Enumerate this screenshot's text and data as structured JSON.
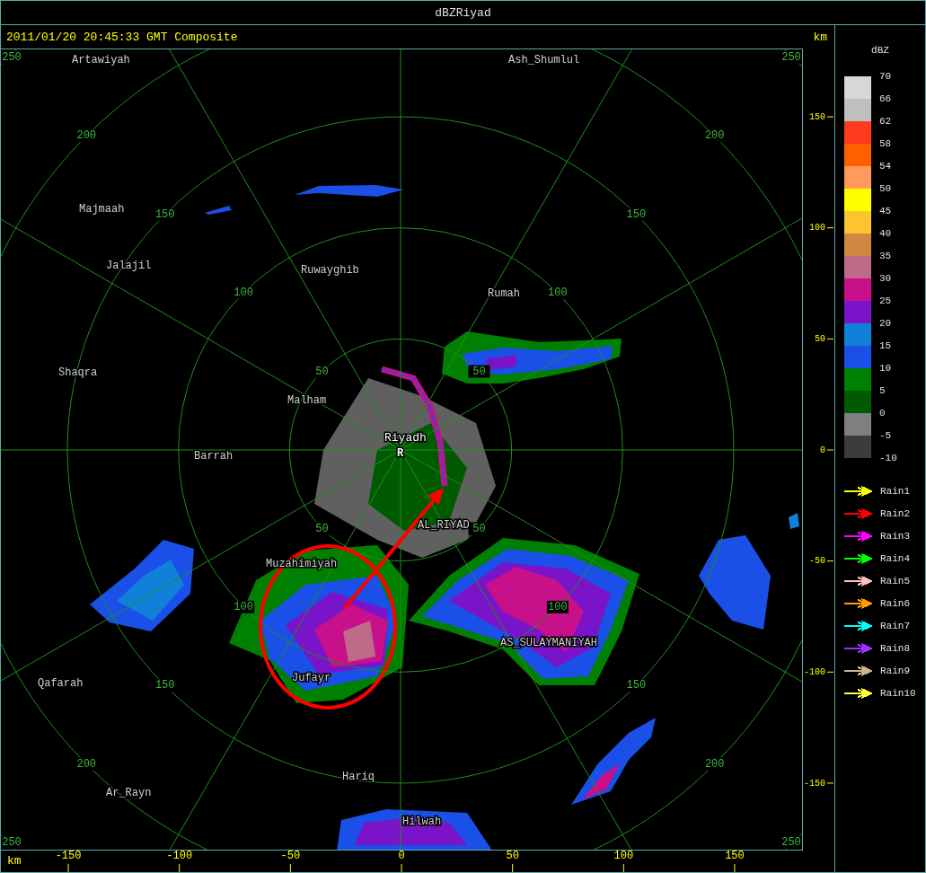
{
  "window": {
    "title": "dBZRiyad"
  },
  "header": {
    "timestamp": "2011/01/20 20:45:33 GMT Composite",
    "unit": "km"
  },
  "map": {
    "places": [
      {
        "name": "Artawiyah",
        "kind": "town"
      },
      {
        "name": "Ash_Shumlul",
        "kind": "town"
      },
      {
        "name": "Majmaah",
        "kind": "town"
      },
      {
        "name": "Jalajil",
        "kind": "town"
      },
      {
        "name": "Ruwayghib",
        "kind": "town"
      },
      {
        "name": "Rumah",
        "kind": "town"
      },
      {
        "name": "Shaqra",
        "kind": "town"
      },
      {
        "name": "Malham",
        "kind": "town"
      },
      {
        "name": "Riyadh",
        "kind": "site"
      },
      {
        "name": "R",
        "kind": "marker"
      },
      {
        "name": "Barrah",
        "kind": "town"
      },
      {
        "name": "AL_RIYAD",
        "kind": "town"
      },
      {
        "name": "Muzahimiyah",
        "kind": "town"
      },
      {
        "name": "AS_SULAYMANIYAH",
        "kind": "town"
      },
      {
        "name": "Jufayr",
        "kind": "town"
      },
      {
        "name": "Qafarah",
        "kind": "town"
      },
      {
        "name": "Hariq",
        "kind": "town"
      },
      {
        "name": "Ar_Rayn",
        "kind": "town"
      },
      {
        "name": "Hilwah",
        "kind": "town"
      }
    ],
    "ring_labels": [
      [
        "50",
        "100",
        "150",
        "200",
        "250"
      ],
      [
        "50",
        "100",
        "150",
        "200",
        "250"
      ],
      [
        "50",
        "100",
        "150",
        "200",
        "250"
      ],
      [
        "50",
        "100",
        "150",
        "200",
        "250"
      ]
    ]
  },
  "y_axis": {
    "ticks": [
      "150",
      "100",
      "50",
      "0",
      "-50",
      "-100",
      "-150"
    ]
  },
  "x_axis": {
    "unit": "km",
    "ticks": [
      "-150",
      "-100",
      "-50",
      "0",
      "50",
      "100",
      "150"
    ]
  },
  "dbz_scale": {
    "title": "dBZ",
    "labels": [
      "70",
      "66",
      "62",
      "58",
      "54",
      "50",
      "45",
      "40",
      "35",
      "30",
      "25",
      "20",
      "15",
      "10",
      "5",
      "0",
      "-5",
      "-10"
    ],
    "bands": [
      {
        "color": "#d7d7d7"
      },
      {
        "color": "#bfbfbf"
      },
      {
        "color": "#ff3a1f"
      },
      {
        "color": "#ff6000"
      },
      {
        "color": "#ff9a5a"
      },
      {
        "color": "#ffff00"
      },
      {
        "color": "#fcc530"
      },
      {
        "color": "#d08840"
      },
      {
        "color": "#c06a8a"
      },
      {
        "color": "#c8108a"
      },
      {
        "color": "#7a14c8"
      },
      {
        "color": "#1080d8"
      },
      {
        "color": "#1a50e8"
      },
      {
        "color": "#008000"
      },
      {
        "color": "#005a00"
      },
      {
        "color": "#808080"
      },
      {
        "color": "#3c3c3c"
      }
    ]
  },
  "rain_legend": [
    {
      "label": "Rain1",
      "color": "#ffff00"
    },
    {
      "label": "Rain2",
      "color": "#ff0000"
    },
    {
      "label": "Rain3",
      "color": "#ff00ff"
    },
    {
      "label": "Rain4",
      "color": "#00ff00"
    },
    {
      "label": "Rain5",
      "color": "#ffc0c0"
    },
    {
      "label": "Rain6",
      "color": "#ffa000"
    },
    {
      "label": "Rain7",
      "color": "#00ffff"
    },
    {
      "label": "Rain8",
      "color": "#a030ff"
    },
    {
      "label": "Rain9",
      "color": "#d2b48c"
    },
    {
      "label": "Rain10",
      "color": "#ffff40"
    }
  ]
}
